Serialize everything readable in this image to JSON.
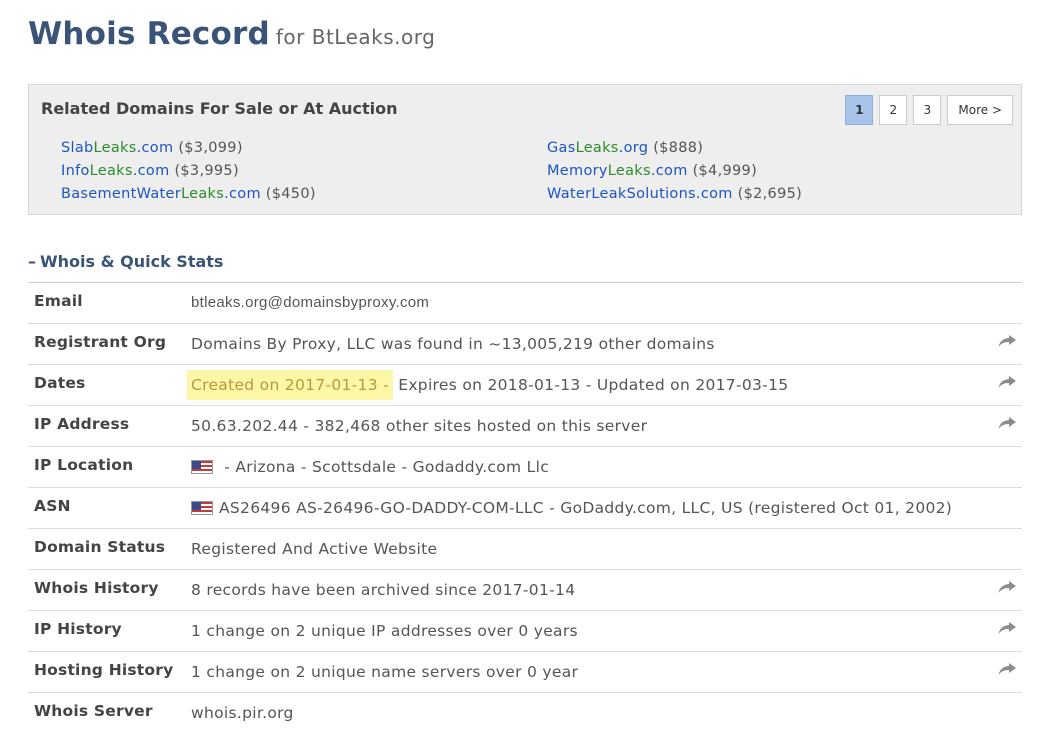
{
  "header": {
    "title": "Whois Record",
    "subtitle": "for BtLeaks.org"
  },
  "related": {
    "title": "Related Domains For Sale or At Auction",
    "pages": [
      "1",
      "2",
      "3"
    ],
    "active_page": "1",
    "more_label": "More >",
    "domains_left": [
      {
        "pre": "Slab",
        "mid": "Leaks",
        "post": ".com",
        "price": "($3,099)"
      },
      {
        "pre": "Info",
        "mid": "Leaks",
        "post": ".com",
        "price": "($3,995)"
      },
      {
        "pre": "BasementWater",
        "mid": "Leaks",
        "post": ".com",
        "price": "($450)"
      }
    ],
    "domains_right": [
      {
        "pre": "Gas",
        "mid": "Leaks",
        "post": ".org",
        "price": "($888)"
      },
      {
        "pre": "Memory",
        "mid": "Leaks",
        "post": ".com",
        "price": "($4,999)"
      },
      {
        "pre": "WaterLeakSolutions.com",
        "mid": "",
        "post": "",
        "price": "($2,695)"
      }
    ]
  },
  "section": {
    "toggle_symbol": "–",
    "title": "Whois & Quick Stats"
  },
  "rows": {
    "email": {
      "label": "Email",
      "value": "btleaks.org@domainsbyproxy.com"
    },
    "registrant": {
      "label": "Registrant Org",
      "value": "Domains By Proxy, LLC was found in ~13,005,219 other domains"
    },
    "dates": {
      "label": "Dates",
      "created": "Created on 2017-01-13 -",
      "rest": " Expires on 2018-01-13 - Updated on 2017-03-15"
    },
    "ip": {
      "label": "IP Address",
      "value": "50.63.202.44 - 382,468 other sites hosted on this server"
    },
    "iploc": {
      "label": "IP Location",
      "value": " - Arizona - Scottsdale - Godaddy.com Llc"
    },
    "asn": {
      "label": "ASN",
      "value": "AS26496 AS-26496-GO-DADDY-COM-LLC - GoDaddy.com, LLC, US (registered Oct 01, 2002)"
    },
    "status": {
      "label": "Domain Status",
      "value": "Registered And Active Website"
    },
    "whois_history": {
      "label": "Whois History",
      "value": "8 records have been archived since 2017-01-14"
    },
    "ip_history": {
      "label": "IP History",
      "value": "1 change on 2 unique IP addresses over 0 years"
    },
    "hosting_history": {
      "label": "Hosting History",
      "value": "1 change on 2 unique name servers over 0 year"
    },
    "server": {
      "label": "Whois Server",
      "value": "whois.pir.org"
    }
  },
  "icons": {
    "share": "share-arrow-icon",
    "flag": "us-flag-icon"
  },
  "colors": {
    "title": "#3a5478",
    "link_blue": "#1f55c0",
    "link_green": "#2e8b2e",
    "highlight": "#fbf7a6",
    "active_page": "#a8c4ea"
  }
}
